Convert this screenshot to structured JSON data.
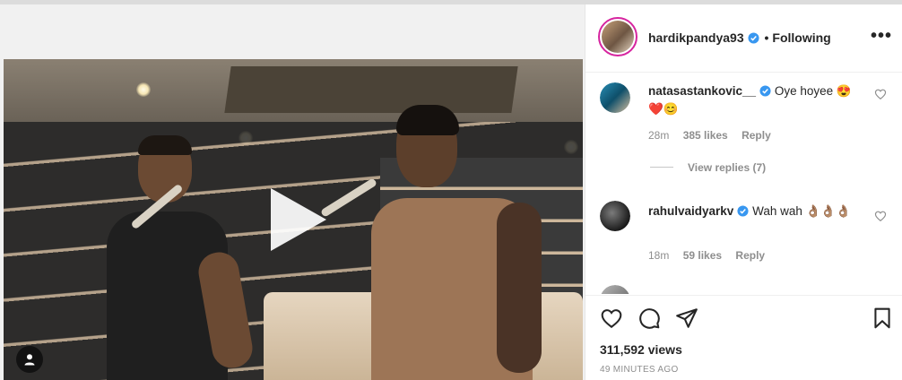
{
  "post": {
    "author": "hardikpandya93",
    "separator": "•",
    "follow_status": "Following",
    "more_label": "•••",
    "views": "311,592 views",
    "time_ago": "49 MINUTES AGO"
  },
  "comments": [
    {
      "user": "natasastankovic__",
      "verified": true,
      "text": "Oye hoyee 😍❤️😊",
      "time": "28m",
      "likes": "385 likes",
      "reply": "Reply",
      "view_replies": "View replies (7)"
    },
    {
      "user": "rahulvaidyarkv",
      "verified": true,
      "text": "Wah wah 👌🏽👌🏽👌🏽",
      "time": "18m",
      "likes": "59 likes",
      "reply": "Reply"
    }
  ],
  "icons": {
    "play": "play-icon",
    "tag": "user-tag-icon",
    "like": "heart-icon",
    "comment": "comment-icon",
    "share": "paper-plane-icon",
    "save": "bookmark-icon",
    "verified": "verified-badge-icon"
  },
  "colors": {
    "verified": "#3897f0",
    "story_ring": "#d6249f",
    "muted_text": "#8e8e8e"
  }
}
